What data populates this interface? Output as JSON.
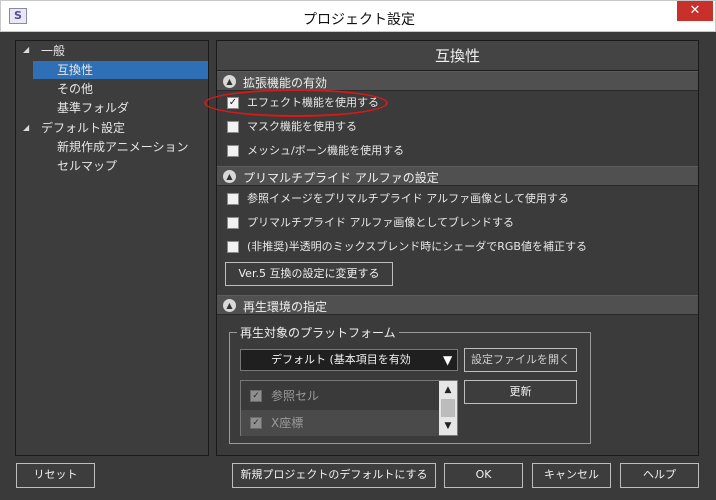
{
  "window": {
    "title": "プロジェクト設定",
    "app_icon": "S",
    "close_glyph": "✕"
  },
  "tree": {
    "items": [
      {
        "label": "一般",
        "expanded": true
      },
      {
        "label": "互換性",
        "selected": true
      },
      {
        "label": "その他"
      },
      {
        "label": "基準フォルダ"
      },
      {
        "label": "デフォルト設定",
        "expanded": true
      },
      {
        "label": "新規作成アニメーション"
      },
      {
        "label": "セルマップ"
      }
    ]
  },
  "panel": {
    "title": "互換性",
    "sections": {
      "extensions": {
        "label": "拡張機能の有効",
        "items": [
          {
            "label": "エフェクト機能を使用する",
            "checked": true
          },
          {
            "label": "マスク機能を使用する",
            "checked": false
          },
          {
            "label": "メッシュ/ボーン機能を使用する",
            "checked": false
          }
        ]
      },
      "premult": {
        "label": "プリマルチプライド アルファの設定",
        "items": [
          {
            "label": "参照イメージをプリマルチプライド アルファ画像として使用する",
            "checked": false
          },
          {
            "label": "プリマルチプライド アルファ画像としてブレンドする",
            "checked": false
          },
          {
            "label": "(非推奨)半透明のミックスブレンド時にシェーダでRGB値を補正する",
            "checked": false
          }
        ],
        "button": "Ver.5 互換の設定に変更する"
      },
      "playback": {
        "label": "再生環境の指定",
        "group_title": "再生対象のプラットフォーム",
        "platform_selected": "デフォルト (基本項目を有効",
        "list_items": [
          {
            "label": "参照セル",
            "checked": true
          },
          {
            "label": "X座標",
            "checked": true
          }
        ],
        "open_settings_button": "設定ファイルを開く",
        "update_button": "更新"
      }
    }
  },
  "footer": {
    "reset": "リセット",
    "make_default": "新規プロジェクトのデフォルトにする",
    "ok": "OK",
    "cancel": "キャンセル",
    "help": "ヘルプ"
  },
  "glyphs": {
    "check": "✓",
    "collapse": "▲",
    "tree_expanded": "◢",
    "dropdown": "▼",
    "scroll_up": "▲",
    "scroll_down": "▼"
  },
  "colors": {
    "selection": "#2f6fb6",
    "annotation_ellipse": "#d41a1a",
    "close_button": "#c7302b"
  }
}
